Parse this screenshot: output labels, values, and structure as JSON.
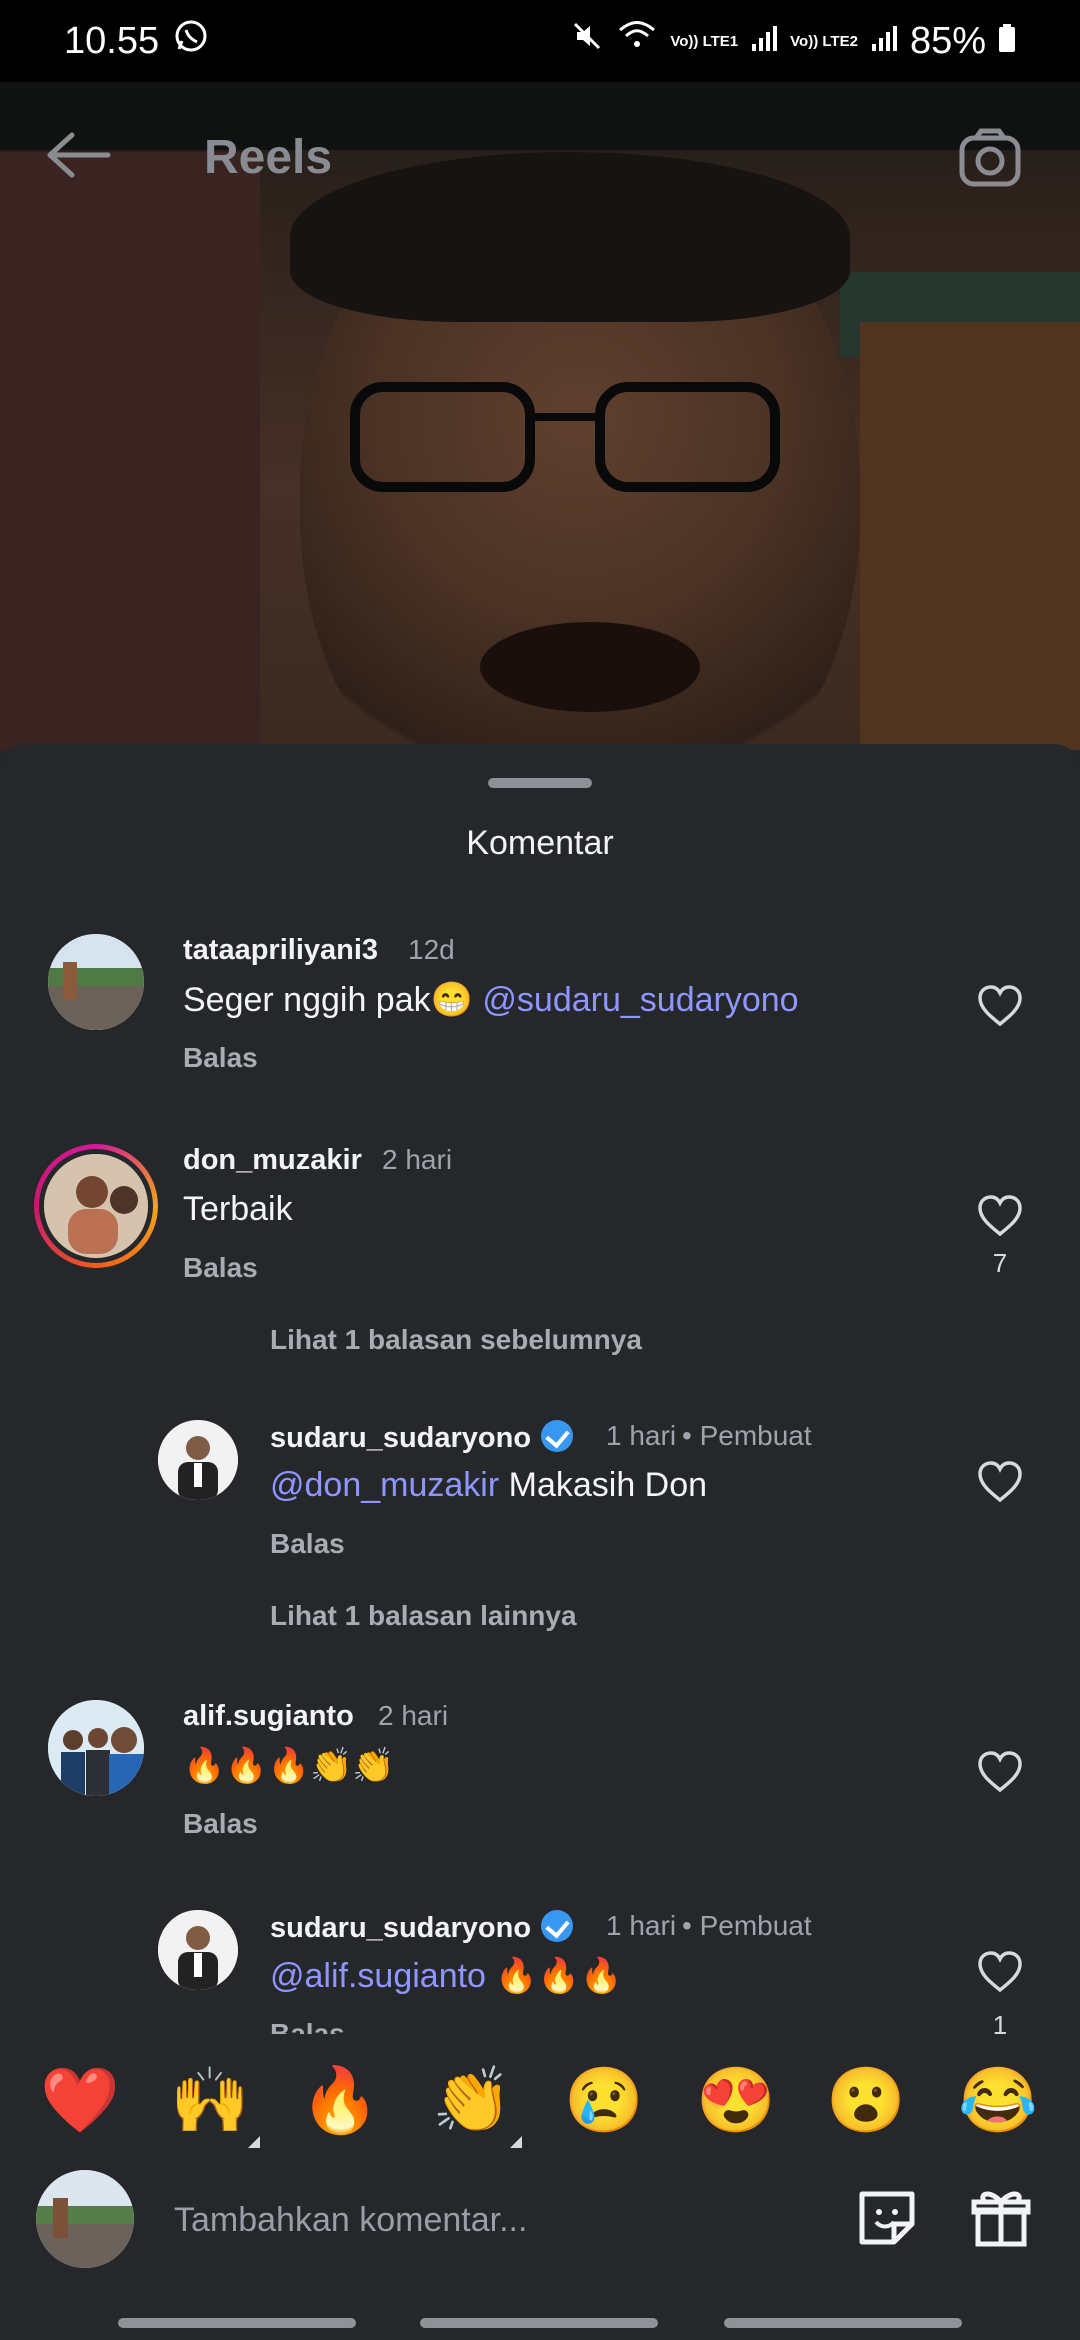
{
  "status": {
    "time": "10.55",
    "signal1": "Vo)) LTE1",
    "signal2": "Vo)) LTE2",
    "battery": "85%"
  },
  "header": {
    "title": "Reels"
  },
  "sheet": {
    "title": "Komentar"
  },
  "comments": [
    {
      "user": "tataapriliyani3",
      "time": "12d",
      "text": "Seger nggih pak😁",
      "mention": "@sudaru_sudaryono",
      "reply": "Balas",
      "likes": ""
    },
    {
      "user": "don_muzakir",
      "time": "2 hari",
      "text": "Terbaik",
      "reply": "Balas",
      "likes": "7",
      "view_replies": "Lihat 1 balasan sebelumnya"
    },
    {
      "user": "sudaru_sudaryono",
      "time": "1 hari",
      "author_tag": "• Pembuat",
      "mention": "@don_muzakir",
      "text": " Makasih Don",
      "reply": "Balas",
      "likes": "",
      "view_replies": "Lihat 1 balasan lainnya"
    },
    {
      "user": "alif.sugianto",
      "time": "2 hari",
      "text": "🔥🔥🔥👏👏",
      "reply": "Balas",
      "likes": ""
    },
    {
      "user": "sudaru_sudaryono",
      "time": "1 hari",
      "author_tag": "• Pembuat",
      "mention": "@alif.sugianto",
      "text": " 🔥🔥🔥",
      "reply": "Balas",
      "likes": "1"
    }
  ],
  "emoji_reactions": [
    "❤️",
    "🙌",
    "🔥",
    "👏",
    "😢",
    "😍",
    "😮",
    "😂"
  ],
  "composer": {
    "placeholder": "Tambahkan komentar..."
  },
  "icons": {
    "back": "back-arrow-icon",
    "camera": "camera-icon",
    "heart": "heart-icon",
    "verified": "verified-badge-icon",
    "sticker": "sticker-icon",
    "gift": "gift-icon"
  },
  "colors": {
    "sheet_background": "#25272b",
    "mention": "#8f96ff",
    "verified": "#3897f0"
  }
}
